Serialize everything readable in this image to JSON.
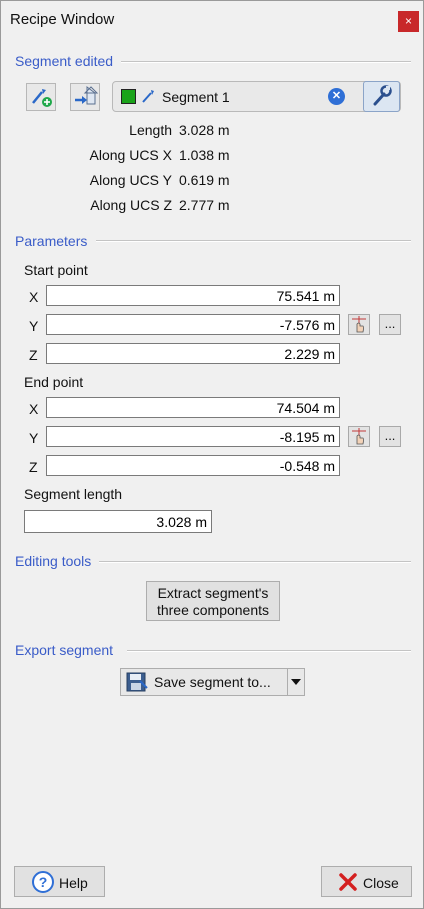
{
  "window": {
    "title": "Recipe Window",
    "close_symbol": "×"
  },
  "segment_section": {
    "title": "Segment edited",
    "segment_name": "Segment 1",
    "swatch_color": "#1aa31a",
    "remove_symbol": "✕",
    "info": [
      {
        "label": "Length",
        "value": "3.028 m"
      },
      {
        "label": "Along UCS X",
        "value": "1.038 m"
      },
      {
        "label": "Along UCS Y",
        "value": "0.619 m"
      },
      {
        "label": "Along UCS Z",
        "value": "2.777 m"
      }
    ]
  },
  "parameters": {
    "title": "Parameters",
    "start_point": {
      "label": "Start point",
      "x_label": "X",
      "y_label": "Y",
      "z_label": "Z",
      "x": "75.541 m",
      "y": "-7.576 m",
      "z": "2.229 m"
    },
    "end_point": {
      "label": "End point",
      "x_label": "X",
      "y_label": "Y",
      "z_label": "Z",
      "x": "74.504 m",
      "y": "-8.195 m",
      "z": "-0.548 m"
    },
    "more_label": "...",
    "segment_length_label": "Segment length",
    "segment_length": "3.028 m"
  },
  "editing_tools": {
    "title": "Editing tools",
    "extract_line1": "Extract segment's",
    "extract_line2": "three components"
  },
  "export": {
    "title": "Export segment",
    "save_label": "Save segment to..."
  },
  "footer": {
    "help_label": "Help",
    "close_label": "Close"
  },
  "colors": {
    "accent": "#3a5cc8",
    "close_red": "#c8282a",
    "help_blue": "#2f6fd6"
  }
}
